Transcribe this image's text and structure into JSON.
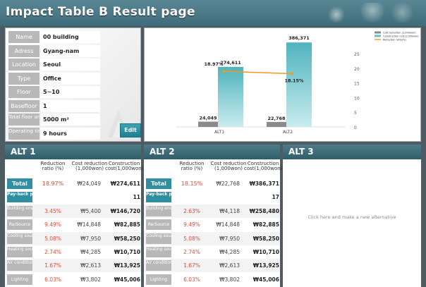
{
  "header": {
    "title": "Impact Table B Result page"
  },
  "info": {
    "rows": [
      {
        "label": "Name",
        "value": "00 building"
      },
      {
        "label": "Adress",
        "value": "Gyang-nam"
      },
      {
        "label": "Location",
        "value": "Seoul"
      },
      {
        "label": "Type",
        "value": "Office"
      },
      {
        "label": "Floor",
        "value": "5~10"
      },
      {
        "label": "Basefloor",
        "value": "1"
      },
      {
        "label": "Total floor area",
        "value": "5000 m²"
      },
      {
        "label": "Operating time",
        "value": "9 hours"
      }
    ],
    "edit_label": "Edit"
  },
  "chart_data": {
    "type": "bar",
    "categories": [
      "ALT1",
      "ALT2"
    ],
    "series": [
      {
        "name": "Cost reduction (1,000won)",
        "values": [
          24049,
          22768
        ],
        "color": "#8a8a8a",
        "labels": [
          "24,049",
          "22,768"
        ]
      },
      {
        "name": "Construction cost(1,000won)",
        "values": [
          274611,
          386371
        ],
        "color": "#5fc0c8",
        "labels": [
          "274,611",
          "386,371"
        ]
      },
      {
        "name": "Reduction ratio(%)",
        "values": [
          18.97,
          18.15
        ],
        "color": "#f29a1f",
        "labels": [
          "18.97%",
          "18.15%"
        ],
        "axis": "right"
      }
    ],
    "right_axis": {
      "ticks": [
        "0",
        "5",
        "10",
        "15",
        "20",
        "25"
      ],
      "ylim": [
        0,
        25
      ]
    },
    "legend_position": "top-right",
    "legend": [
      "Cost reduction (1,000won)",
      "Construction cost(1,000won)",
      "Reduction ratio(%)"
    ]
  },
  "table_header": {
    "ratio": "Reduction ratio (%)",
    "cost": "Cost reduction (1,000won)",
    "construction": "Construction cost(1,000won)"
  },
  "alt1": {
    "title": "ALT 1",
    "rows": [
      {
        "label": "Total",
        "ratio": "18.97%",
        "cost": "₩24,049",
        "construction": "₩274,611"
      },
      {
        "label": "Pay-back period",
        "ratio": "",
        "cost": "",
        "construction": "11"
      },
      {
        "label": "Building envelop",
        "ratio": "3.45%",
        "cost": "₩5,400",
        "construction": "₩146,720"
      },
      {
        "label": "Re/Source",
        "ratio": "9.49%",
        "cost": "₩14,848",
        "construction": "₩82,885"
      },
      {
        "label": "Cooling source",
        "ratio": "5.08%",
        "cost": "₩7,950",
        "construction": "₩58,250"
      },
      {
        "label": "Heating source",
        "ratio": "2.74%",
        "cost": "₩4,285",
        "construction": "₩10,710"
      },
      {
        "label": "Air conditioning",
        "ratio": "1.67%",
        "cost": "₩2,613",
        "construction": "₩13,925"
      },
      {
        "label": "Lighting",
        "ratio": "6.03%",
        "cost": "₩3,802",
        "construction": "₩45,006"
      }
    ]
  },
  "alt2": {
    "title": "ALT 2",
    "rows": [
      {
        "label": "Total",
        "ratio": "18.15%",
        "cost": "₩22,768",
        "construction": "₩386,371"
      },
      {
        "label": "Pay-back period",
        "ratio": "",
        "cost": "",
        "construction": "17"
      },
      {
        "label": "Building envelop",
        "ratio": "2.63%",
        "cost": "₩4,118",
        "construction": "₩258,480"
      },
      {
        "label": "Re/Source",
        "ratio": "9.49%",
        "cost": "₩14,848",
        "construction": "₩82,885"
      },
      {
        "label": "Cooling source",
        "ratio": "5.08%",
        "cost": "₩7,950",
        "construction": "₩58,250"
      },
      {
        "label": "Heating source",
        "ratio": "2.74%",
        "cost": "₩4,285",
        "construction": "₩10,710"
      },
      {
        "label": "Air conditioning",
        "ratio": "1.67%",
        "cost": "₩2,613",
        "construction": "₩13,925"
      },
      {
        "label": "Lighting",
        "ratio": "6.03%",
        "cost": "₩3,802",
        "construction": "₩45,006"
      }
    ]
  },
  "alt3": {
    "title": "ALT 3",
    "message": "Click here and make a new alternative"
  }
}
